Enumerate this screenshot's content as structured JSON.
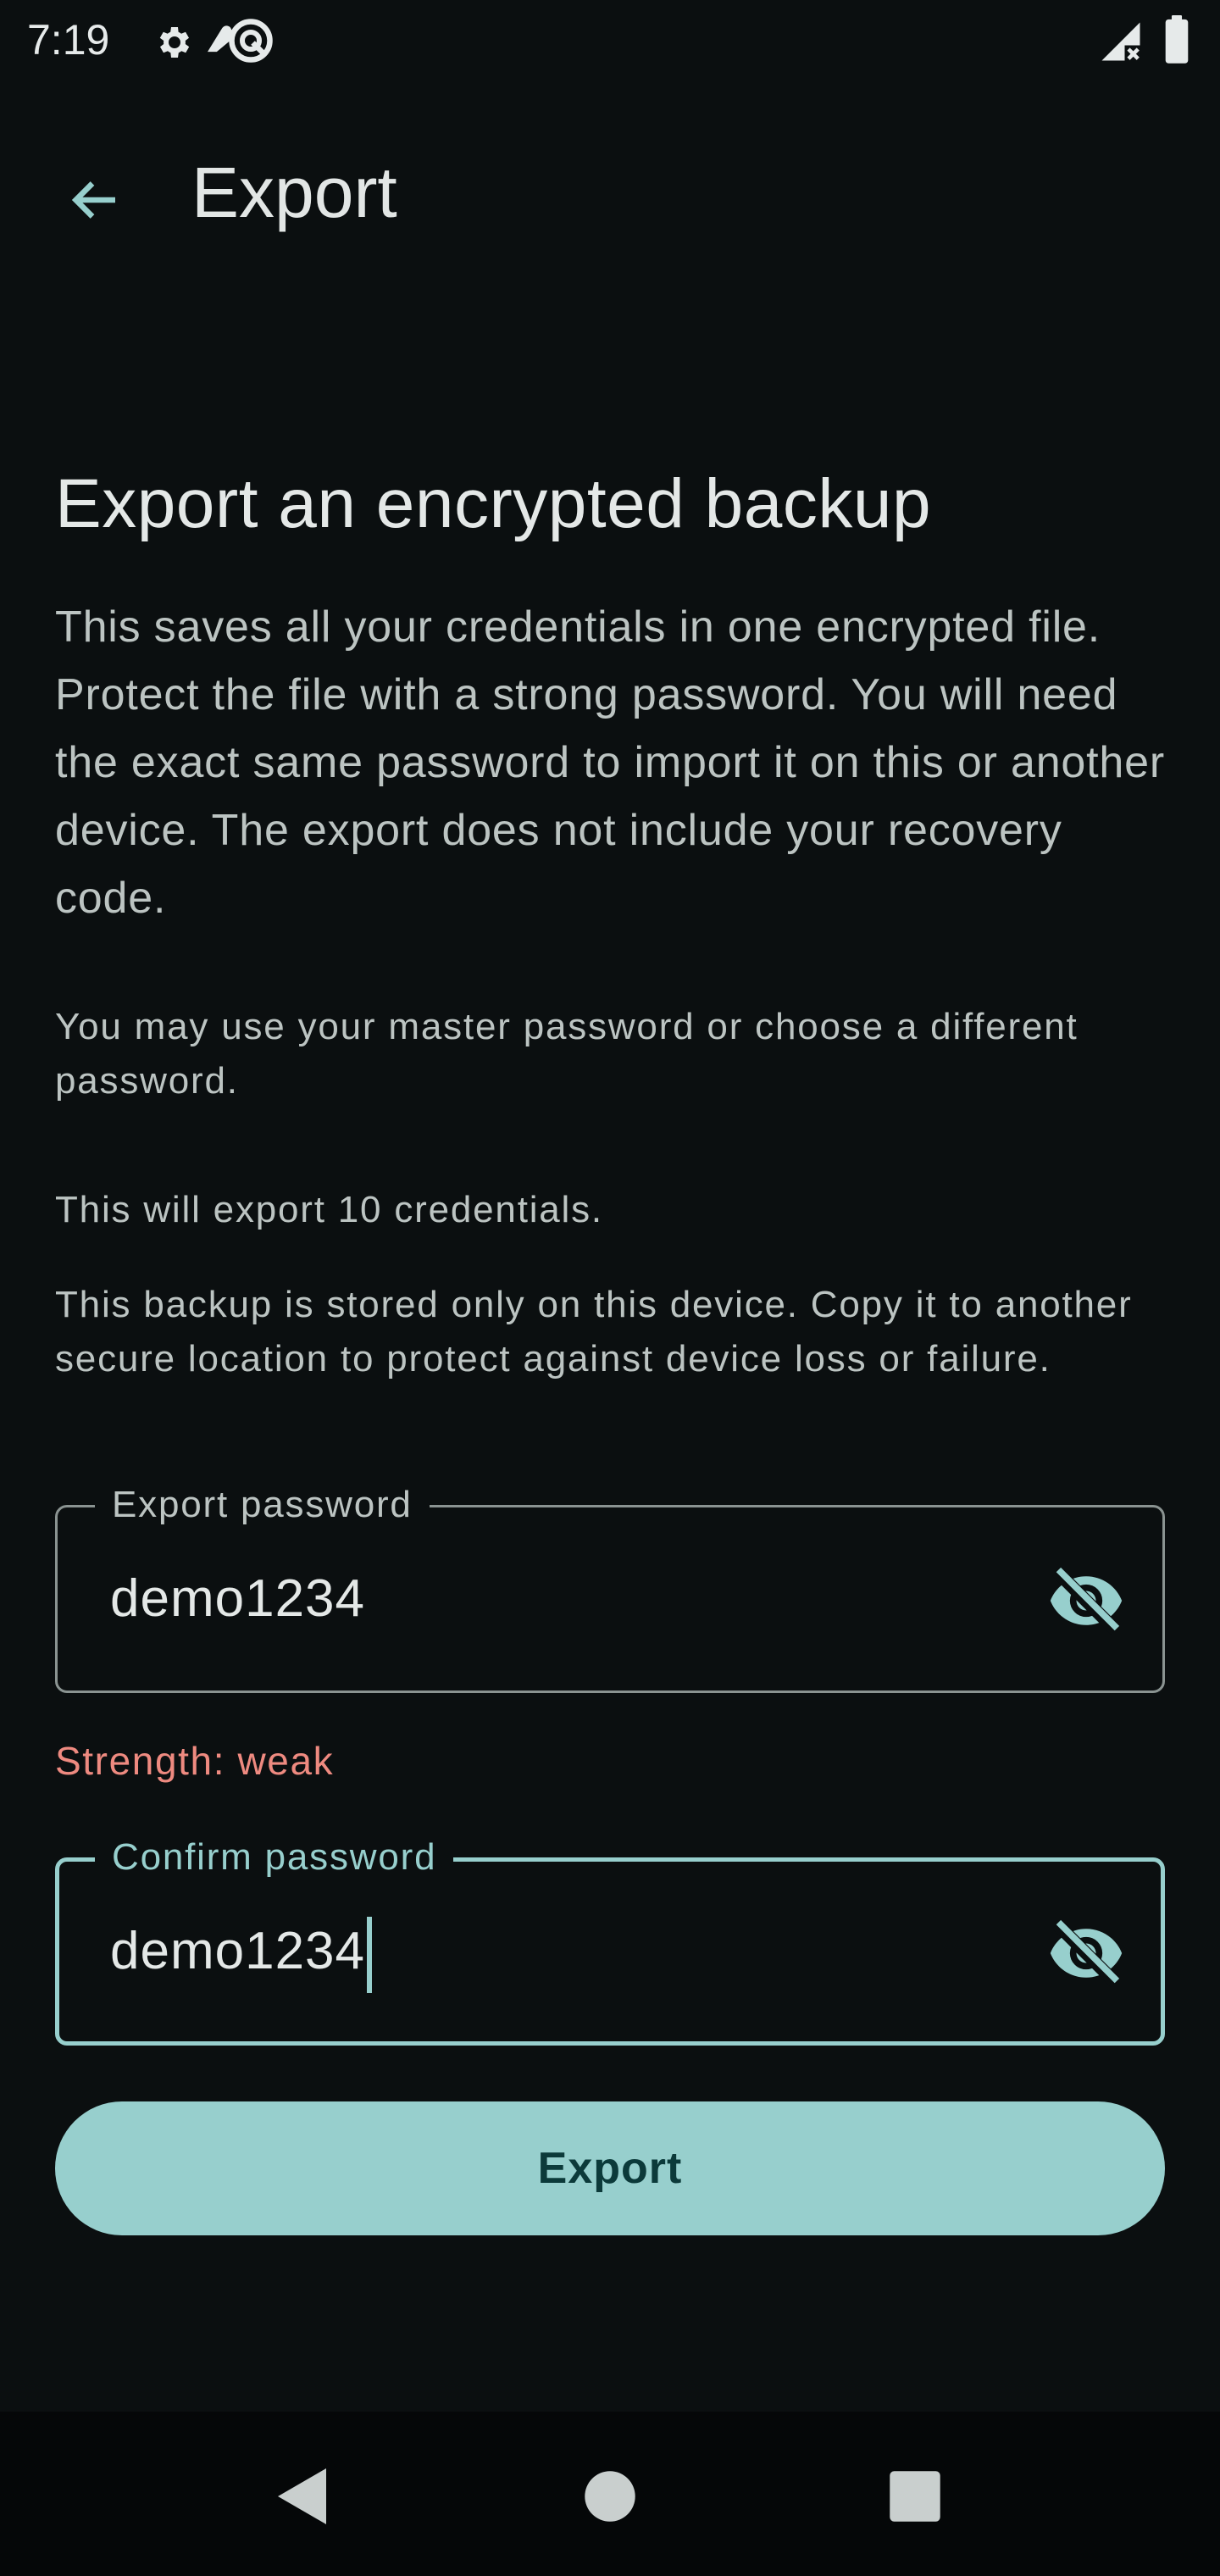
{
  "status_bar": {
    "time": "7:19",
    "icons": [
      "settings-gear-icon",
      "cloud-sync-icon",
      "circle-slash-icon",
      "signal-no-service-icon",
      "battery-full-icon"
    ]
  },
  "app_bar": {
    "title": "Export",
    "back_icon": "arrow-back-icon"
  },
  "content": {
    "heading": "Export an encrypted backup",
    "intro": "This saves all your credentials in one encrypted file. Protect the file with a strong password. You will need the exact same password to import it on this or another device. The export does not include your recovery code.",
    "master_password_note": "You may use your master password or choose a different password.",
    "count_note": "This will export 10 credentials.",
    "storage_note": "This backup is stored only on this device. Copy it to another secure location to protect against device loss or failure."
  },
  "export_password": {
    "label": "Export password",
    "value": "demo1234",
    "toggle_icon": "visibility-off-icon"
  },
  "strength": "Strength: weak",
  "confirm_password": {
    "label": "Confirm password",
    "value": "demo1234",
    "toggle_icon": "visibility-off-icon"
  },
  "export_button": "Export",
  "nav_bar": {
    "icons": [
      "nav-back-icon",
      "nav-home-icon",
      "nav-recents-icon"
    ]
  },
  "colors": {
    "background": "#0b0f10",
    "accent": "#97cfcd",
    "error": "#ee8a80",
    "on_accent": "#0c3a3a"
  }
}
